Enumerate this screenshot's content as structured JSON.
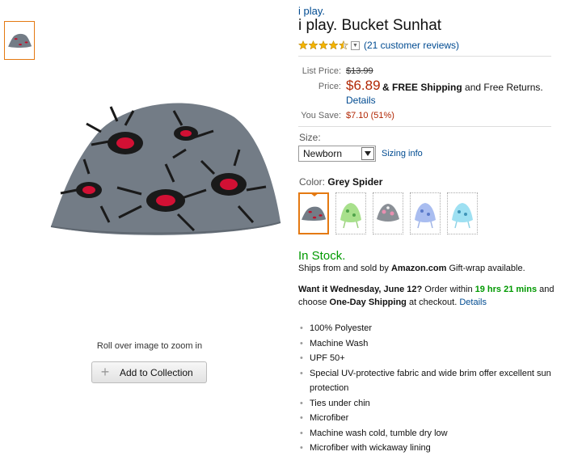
{
  "product": {
    "brand": "i play.",
    "title": "i play. Bucket Sunhat",
    "rating_stars": 4.5,
    "reviews_text": "(21 customer reviews)"
  },
  "pricing": {
    "list_price_label": "List Price:",
    "list_price": "$13.99",
    "price_label": "Price:",
    "price": "$6.89",
    "price_extra_prefix": "& FREE Shipping",
    "price_extra_suffix": "and Free Returns.",
    "details_link": "Details",
    "you_save_label": "You Save:",
    "you_save": "$7.10 (51%)"
  },
  "size": {
    "label": "Size:",
    "selected": "Newborn",
    "sizing_info": "Sizing info"
  },
  "color": {
    "label": "Color:",
    "selected": "Grey Spider",
    "swatches": [
      "Grey Spider",
      "Green",
      "Grey Floral",
      "Blue Floral",
      "Aqua Print"
    ]
  },
  "availability": {
    "stock": "In Stock.",
    "ships_prefix": "Ships from and sold by",
    "ships_seller": "Amazon.com",
    "ships_suffix": "Gift-wrap available.",
    "want_it": "Want it Wednesday, June 12?",
    "order_within": "Order within",
    "time_left": "19 hrs 21 mins",
    "and": "and",
    "choose": "choose",
    "shipping_option": "One-Day Shipping",
    "at_checkout": "at checkout.",
    "details_link": "Details"
  },
  "features": [
    "100% Polyester",
    "Machine Wash",
    "UPF 50+",
    "Special UV-protective fabric and wide brim offer excellent sun protection",
    "Ties under chin",
    "Microfiber",
    "Machine wash cold, tumble dry low",
    "Microfiber with wickaway lining"
  ],
  "image_panel": {
    "zoom_hint": "Roll over image to zoom in",
    "add_to_collection": "Add to Collection"
  },
  "colors": {
    "link": "#004B91",
    "price_red": "#B12704",
    "in_stock_green": "#009900",
    "selected_border": "#E47911",
    "hat_grey": "#737C86"
  }
}
